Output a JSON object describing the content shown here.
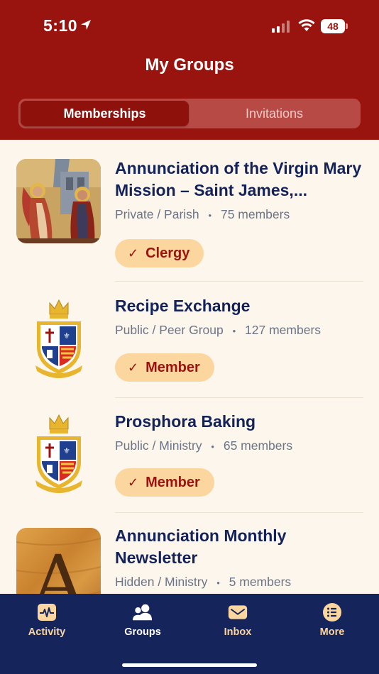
{
  "status_bar": {
    "time": "5:10",
    "battery": "48"
  },
  "header": {
    "title": "My Groups"
  },
  "segments": {
    "memberships": "Memberships",
    "invitations": "Invitations"
  },
  "groups": [
    {
      "title": "Annunciation of the Virgin Mary Mission – Saint James,...",
      "type": "Private / Parish",
      "members": "75 members",
      "role": "Clergy",
      "icon": "annunciation-icon-image"
    },
    {
      "title": "Recipe Exchange",
      "type": "Public / Peer Group",
      "members": "127 members",
      "role": "Member",
      "icon": "crest-icon"
    },
    {
      "title": "Prosphora Baking",
      "type": "Public / Ministry",
      "members": "65 members",
      "role": "Member",
      "icon": "crest-icon"
    },
    {
      "title": "Annunciation Monthly Newsletter",
      "type": "Hidden / Ministry",
      "members": "5 members",
      "icon": "letter-a-wood-icon",
      "thumb_letter": "A"
    }
  ],
  "separator": "•",
  "tabs": [
    {
      "label": "Activity",
      "icon": "activity-icon"
    },
    {
      "label": "Groups",
      "icon": "groups-icon"
    },
    {
      "label": "Inbox",
      "icon": "inbox-icon"
    },
    {
      "label": "More",
      "icon": "more-list-icon"
    }
  ],
  "colors": {
    "header": "#9a140f",
    "navy": "#15245a",
    "badge": "#fbd69e",
    "background": "#fdf6ec"
  }
}
